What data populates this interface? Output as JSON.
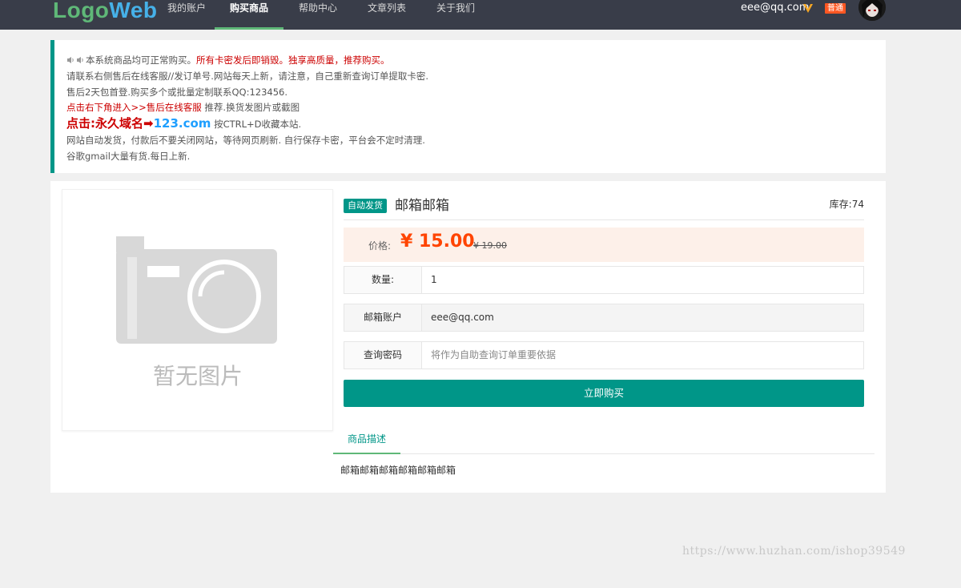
{
  "header": {
    "logo_part1": "Logo",
    "logo_part2": "Web",
    "nav": [
      {
        "label": "我的账户"
      },
      {
        "label": "购买商品",
        "active": true
      },
      {
        "label": "帮助中心"
      },
      {
        "label": "文章列表"
      },
      {
        "label": "关于我们"
      }
    ],
    "user_email": "eee@qq.com",
    "user_level": "普通",
    "vip_icon": "v-badge-icon",
    "avatar_icon": "avatar"
  },
  "notice": {
    "line1_a": "本系统商品均可正常购买。",
    "line1_b": "所有卡密发后即销毁。独享高质量，推荐购买。",
    "line2": "请联系右侧售后在线客服//发订单号.网站每天上新，请注意，自己重新查询订单提取卡密.",
    "line3": "售后2天包首登.购买多个或批量定制联系QQ:123456.",
    "line4_a": "点击右下角进入>>售后在线客服",
    "line4_b": " 推荐.换货发图片或截图",
    "line5_a": "点击:永久域名➡",
    "line5_b": "123.com",
    "line5_c": " 按CTRL+D收藏本站.",
    "line6": "网站自动发货，付款后不要关闭网站，等待网页刷新. 自行保存卡密，平台会不定时清理.",
    "line7": "谷歌gmail大量有货.每日上新."
  },
  "product": {
    "image_placeholder_text": "暂无图片",
    "badge": "自动发货",
    "title": "邮箱邮箱",
    "stock": "库存:74",
    "price_label": "价格:",
    "price_now": "¥ 15.00",
    "price_old": "¥ 19.00",
    "quantity_label": "数量:",
    "quantity_value": "1",
    "email_label": "邮箱账户",
    "email_value": "eee@qq.com",
    "query_label": "查询密码",
    "query_placeholder": "将作为自助查询订单重要依据",
    "buy_button": "立即购买",
    "tab_description": "商品描述",
    "description": "邮箱邮箱邮箱邮箱邮箱邮箱"
  },
  "watermark": "https://www.huzhan.com/ishop39549",
  "colors": {
    "nav_bg": "#393d49",
    "accent": "#009688",
    "tab_underline": "#5fb878",
    "price": "#ff4400",
    "level_badge": "#ff5722"
  }
}
